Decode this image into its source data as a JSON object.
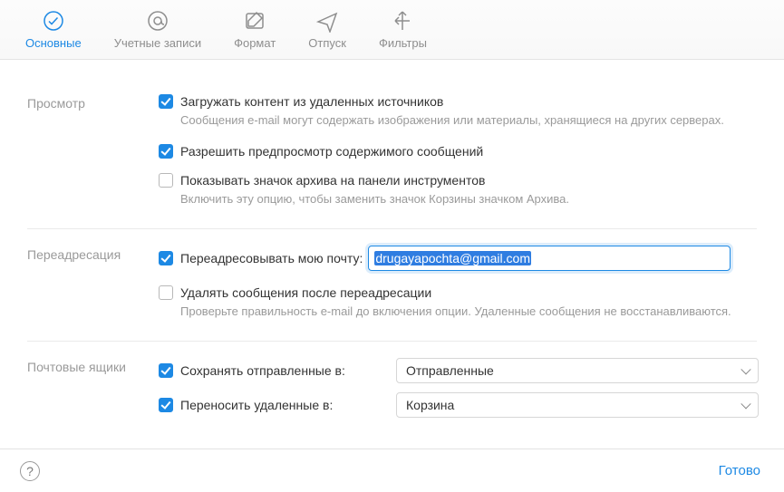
{
  "tabs": [
    {
      "label": "Основные"
    },
    {
      "label": "Учетные записи"
    },
    {
      "label": "Формат"
    },
    {
      "label": "Отпуск"
    },
    {
      "label": "Фильтры"
    }
  ],
  "sections": {
    "viewing": {
      "title": "Просмотр",
      "remote_content": {
        "checked": true,
        "label": "Загружать контент из удаленных источников",
        "hint": "Сообщения e-mail могут содержать изображения или материалы, хранящиеся на других серверах."
      },
      "preview": {
        "checked": true,
        "label": "Разрешить предпросмотр содержимого сообщений"
      },
      "archive_icon": {
        "checked": false,
        "label": "Показывать значок архива на панели инструментов",
        "hint": "Включить эту опцию, чтобы заменить значок Корзины значком Архива."
      }
    },
    "forwarding": {
      "title": "Переадресация",
      "forward": {
        "checked": true,
        "label": "Переадресовывать мою почту:",
        "value": "drugayapochta@gmail.com"
      },
      "delete_after": {
        "checked": false,
        "label": "Удалять сообщения после переадресации",
        "hint": "Проверьте правильность e-mail до включения опции. Удаленные сообщения не восстанавливаются."
      }
    },
    "mailboxes": {
      "title": "Почтовые ящики",
      "sent": {
        "checked": true,
        "label": "Сохранять отправленные в:",
        "value": "Отправленные"
      },
      "trash": {
        "checked": true,
        "label": "Переносить удаленные в:",
        "value": "Корзина"
      }
    }
  },
  "footer": {
    "done": "Готово"
  }
}
